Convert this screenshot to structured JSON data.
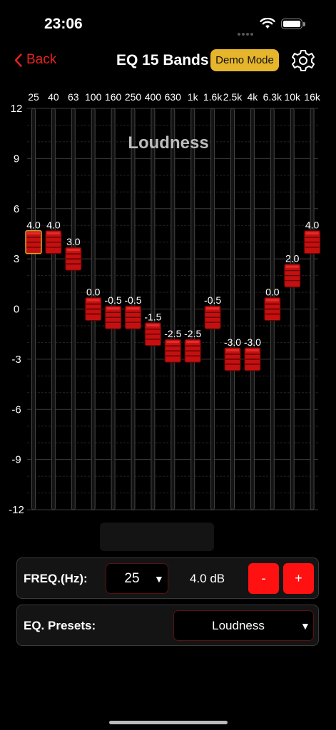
{
  "status": {
    "time": "23:06"
  },
  "nav": {
    "back_label": "Back",
    "title": "EQ 15 Bands",
    "demo_label": "Demo Mode"
  },
  "eq": {
    "preset_title": "Loudness",
    "y_ticks": [
      "12",
      "9",
      "6",
      "3",
      "0",
      "-3",
      "-6",
      "-9",
      "-12"
    ],
    "bands": [
      {
        "freq": "25",
        "gain": 4.0,
        "label": "4.0",
        "selected": true
      },
      {
        "freq": "40",
        "gain": 4.0,
        "label": "4.0"
      },
      {
        "freq": "63",
        "gain": 3.0,
        "label": "3.0"
      },
      {
        "freq": "100",
        "gain": 0.0,
        "label": "0.0"
      },
      {
        "freq": "160",
        "gain": -0.5,
        "label": "-0.5"
      },
      {
        "freq": "250",
        "gain": -0.5,
        "label": "-0.5"
      },
      {
        "freq": "400",
        "gain": -1.5,
        "label": "-1.5"
      },
      {
        "freq": "630",
        "gain": -2.5,
        "label": "-2.5"
      },
      {
        "freq": "1k",
        "gain": -2.5,
        "label": "-2.5"
      },
      {
        "freq": "1.6k",
        "gain": -0.5,
        "label": "-0.5"
      },
      {
        "freq": "2.5k",
        "gain": -3.0,
        "label": "-3.0"
      },
      {
        "freq": "4k",
        "gain": -3.0,
        "label": "-3.0"
      },
      {
        "freq": "6.3k",
        "gain": 0.0,
        "label": "0.0"
      },
      {
        "freq": "10k",
        "gain": 2.0,
        "label": "2.0"
      },
      {
        "freq": "16k",
        "gain": 4.0,
        "label": "4.0"
      }
    ],
    "range": [
      -12,
      12
    ]
  },
  "controls": {
    "freq_label": "FREQ.(Hz):",
    "freq_value": "25",
    "db_value": "4.0 dB",
    "minus_label": "-",
    "plus_label": "+",
    "presets_label": "EQ. Presets:",
    "preset_value": "Loudness"
  },
  "colors": {
    "accent_red": "#ff1111",
    "back_red": "#e8221d",
    "demo_gold": "#e5b52c",
    "handle_red": "#c41010"
  }
}
